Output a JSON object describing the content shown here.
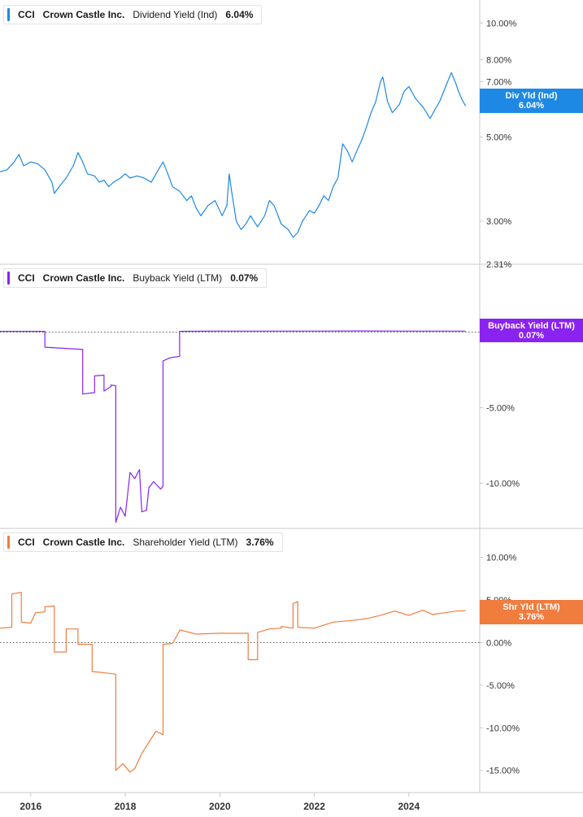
{
  "colors": {
    "dividend": "#1e88e5",
    "buyback": "#8a22f0",
    "shareholder": "#f07c3e",
    "axis": "#c8c8c8",
    "zero_line": "#555555"
  },
  "x_axis": {
    "tick_labels": [
      "2016",
      "2018",
      "2020",
      "2022",
      "2024"
    ],
    "tick_values": [
      2016,
      2018,
      2020,
      2022,
      2024
    ],
    "range": [
      2015.35,
      2025.5
    ]
  },
  "chart_data": [
    {
      "type": "line",
      "legend": {
        "ticker": "CCI",
        "company": "Crown Castle Inc.",
        "metric": "Dividend Yield (Ind)",
        "value": "6.04%"
      },
      "flag": {
        "line1": "Div Yld (Ind)",
        "line2": "6.04%"
      },
      "scale": "log",
      "ylim": [
        2.31,
        11.5
      ],
      "y_ticks": [
        10,
        8,
        7,
        5,
        3,
        2.31
      ],
      "y_tick_labels": [
        "10.00%",
        "8.00%",
        "7.00%",
        "5.00%",
        "3.00%",
        "2.31%"
      ],
      "zero_line": false,
      "series": [
        {
          "points": [
            [
              2015.35,
              4.05
            ],
            [
              2015.5,
              4.1
            ],
            [
              2015.65,
              4.3
            ],
            [
              2015.75,
              4.5
            ],
            [
              2015.85,
              4.2
            ],
            [
              2016.0,
              4.3
            ],
            [
              2016.15,
              4.25
            ],
            [
              2016.3,
              4.1
            ],
            [
              2016.45,
              3.8
            ],
            [
              2016.5,
              3.55
            ],
            [
              2016.6,
              3.7
            ],
            [
              2016.75,
              3.9
            ],
            [
              2016.9,
              4.2
            ],
            [
              2017.0,
              4.55
            ],
            [
              2017.1,
              4.3
            ],
            [
              2017.2,
              4.0
            ],
            [
              2017.35,
              3.95
            ],
            [
              2017.45,
              3.8
            ],
            [
              2017.55,
              3.85
            ],
            [
              2017.65,
              3.7
            ],
            [
              2017.75,
              3.8
            ],
            [
              2017.9,
              3.9
            ],
            [
              2018.0,
              4.0
            ],
            [
              2018.1,
              3.9
            ],
            [
              2018.25,
              3.95
            ],
            [
              2018.4,
              3.9
            ],
            [
              2018.55,
              3.8
            ],
            [
              2018.7,
              4.1
            ],
            [
              2018.8,
              4.3
            ],
            [
              2018.9,
              4.0
            ],
            [
              2019.0,
              3.7
            ],
            [
              2019.15,
              3.6
            ],
            [
              2019.3,
              3.4
            ],
            [
              2019.4,
              3.5
            ],
            [
              2019.5,
              3.25
            ],
            [
              2019.6,
              3.1
            ],
            [
              2019.75,
              3.3
            ],
            [
              2019.9,
              3.4
            ],
            [
              2020.05,
              3.1
            ],
            [
              2020.15,
              3.3
            ],
            [
              2020.2,
              4.0
            ],
            [
              2020.25,
              3.6
            ],
            [
              2020.35,
              3.0
            ],
            [
              2020.45,
              2.85
            ],
            [
              2020.55,
              2.95
            ],
            [
              2020.65,
              3.1
            ],
            [
              2020.8,
              2.9
            ],
            [
              2020.95,
              3.1
            ],
            [
              2021.05,
              3.4
            ],
            [
              2021.15,
              3.3
            ],
            [
              2021.3,
              2.95
            ],
            [
              2021.45,
              2.85
            ],
            [
              2021.55,
              2.72
            ],
            [
              2021.65,
              2.8
            ],
            [
              2021.75,
              3.0
            ],
            [
              2021.9,
              3.2
            ],
            [
              2022.0,
              3.15
            ],
            [
              2022.1,
              3.3
            ],
            [
              2022.2,
              3.5
            ],
            [
              2022.3,
              3.4
            ],
            [
              2022.4,
              3.7
            ],
            [
              2022.5,
              3.9
            ],
            [
              2022.6,
              4.8
            ],
            [
              2022.7,
              4.6
            ],
            [
              2022.8,
              4.3
            ],
            [
              2022.9,
              4.6
            ],
            [
              2023.0,
              4.9
            ],
            [
              2023.1,
              5.3
            ],
            [
              2023.2,
              5.8
            ],
            [
              2023.3,
              6.2
            ],
            [
              2023.4,
              7.0
            ],
            [
              2023.45,
              7.2
            ],
            [
              2023.55,
              6.2
            ],
            [
              2023.65,
              5.8
            ],
            [
              2023.8,
              6.1
            ],
            [
              2023.9,
              6.6
            ],
            [
              2024.0,
              6.8
            ],
            [
              2024.15,
              6.3
            ],
            [
              2024.3,
              6.0
            ],
            [
              2024.45,
              5.6
            ],
            [
              2024.55,
              5.9
            ],
            [
              2024.65,
              6.2
            ],
            [
              2024.8,
              6.9
            ],
            [
              2024.9,
              7.4
            ],
            [
              2025.0,
              6.9
            ],
            [
              2025.05,
              6.6
            ],
            [
              2025.12,
              6.3
            ],
            [
              2025.2,
              6.04
            ]
          ]
        }
      ]
    },
    {
      "type": "line",
      "legend": {
        "ticker": "CCI",
        "company": "Crown Castle Inc.",
        "metric": "Buyback Yield (LTM)",
        "value": "0.07%"
      },
      "flag": {
        "line1": "Buyback Yield (LTM)",
        "line2": "0.07%"
      },
      "scale": "linear",
      "ylim": [
        -13.0,
        4.5
      ],
      "y_ticks": [
        -5,
        -10
      ],
      "y_tick_labels": [
        "-5.00%",
        "-10.00%"
      ],
      "zero_line": true,
      "series": [
        {
          "points": [
            [
              2015.35,
              0.05
            ],
            [
              2016.3,
              0.05
            ],
            [
              2016.3,
              -1.0
            ],
            [
              2016.6,
              -1.05
            ],
            [
              2017.1,
              -1.15
            ],
            [
              2017.1,
              -4.1
            ],
            [
              2017.35,
              -4.0
            ],
            [
              2017.35,
              -2.9
            ],
            [
              2017.55,
              -2.85
            ],
            [
              2017.55,
              -3.9
            ],
            [
              2017.7,
              -3.6
            ],
            [
              2017.7,
              -3.5
            ],
            [
              2017.8,
              -3.55
            ],
            [
              2017.8,
              -12.6
            ],
            [
              2017.9,
              -11.6
            ],
            [
              2018.0,
              -12.2
            ],
            [
              2018.1,
              -9.3
            ],
            [
              2018.2,
              -9.7
            ],
            [
              2018.3,
              -9.1
            ],
            [
              2018.35,
              -11.9
            ],
            [
              2018.45,
              -11.8
            ],
            [
              2018.5,
              -10.3
            ],
            [
              2018.6,
              -9.9
            ],
            [
              2018.75,
              -10.4
            ],
            [
              2018.8,
              -10.2
            ],
            [
              2018.8,
              -1.9
            ],
            [
              2018.95,
              -1.7
            ],
            [
              2019.15,
              -1.6
            ],
            [
              2019.15,
              0.05
            ],
            [
              2020.0,
              0.07
            ],
            [
              2021.0,
              0.07
            ],
            [
              2022.0,
              0.07
            ],
            [
              2023.0,
              0.08
            ],
            [
              2024.0,
              0.07
            ],
            [
              2025.2,
              0.07
            ]
          ]
        }
      ]
    },
    {
      "type": "line",
      "legend": {
        "ticker": "CCI",
        "company": "Crown Castle Inc.",
        "metric": "Shareholder Yield (LTM)",
        "value": "3.76%"
      },
      "flag": {
        "line1": "Shr Yld (LTM)",
        "line2": "3.76%"
      },
      "scale": "linear",
      "ylim": [
        -17.6,
        13.4
      ],
      "y_ticks": [
        10,
        5,
        0,
        -5,
        -10,
        -15
      ],
      "y_tick_labels": [
        "10.00%",
        "5.00%",
        "0.00%",
        "-5.00%",
        "-10.00%",
        "-15.00%"
      ],
      "zero_line": true,
      "series": [
        {
          "points": [
            [
              2015.35,
              1.7
            ],
            [
              2015.6,
              1.8
            ],
            [
              2015.6,
              5.7
            ],
            [
              2015.8,
              5.9
            ],
            [
              2015.8,
              2.4
            ],
            [
              2016.0,
              2.3
            ],
            [
              2016.1,
              3.5
            ],
            [
              2016.3,
              3.6
            ],
            [
              2016.3,
              4.2
            ],
            [
              2016.5,
              4.3
            ],
            [
              2016.5,
              -1.1
            ],
            [
              2016.75,
              -1.1
            ],
            [
              2016.75,
              1.6
            ],
            [
              2017.0,
              1.6
            ],
            [
              2017.0,
              -0.2
            ],
            [
              2017.3,
              -0.2
            ],
            [
              2017.3,
              -3.4
            ],
            [
              2017.5,
              -3.5
            ],
            [
              2017.8,
              -3.7
            ],
            [
              2017.8,
              -15.0
            ],
            [
              2017.95,
              -14.2
            ],
            [
              2018.1,
              -15.2
            ],
            [
              2018.2,
              -14.8
            ],
            [
              2018.35,
              -13.0
            ],
            [
              2018.5,
              -11.7
            ],
            [
              2018.65,
              -10.4
            ],
            [
              2018.8,
              -10.8
            ],
            [
              2018.8,
              -0.2
            ],
            [
              2019.0,
              -0.1
            ],
            [
              2019.15,
              1.4
            ],
            [
              2019.15,
              1.5
            ],
            [
              2019.5,
              1.0
            ],
            [
              2020.0,
              1.1
            ],
            [
              2020.6,
              1.1
            ],
            [
              2020.6,
              -2.0
            ],
            [
              2020.8,
              -2.0
            ],
            [
              2020.8,
              1.2
            ],
            [
              2021.05,
              1.6
            ],
            [
              2021.3,
              1.7
            ],
            [
              2021.3,
              1.9
            ],
            [
              2021.55,
              1.7
            ],
            [
              2021.55,
              4.6
            ],
            [
              2021.65,
              4.8
            ],
            [
              2021.65,
              1.8
            ],
            [
              2022.0,
              1.7
            ],
            [
              2022.4,
              2.4
            ],
            [
              2022.8,
              2.6
            ],
            [
              2023.1,
              2.8
            ],
            [
              2023.4,
              3.2
            ],
            [
              2023.7,
              3.7
            ],
            [
              2024.0,
              3.2
            ],
            [
              2024.3,
              3.8
            ],
            [
              2024.5,
              3.3
            ],
            [
              2024.75,
              3.5
            ],
            [
              2025.0,
              3.7
            ],
            [
              2025.2,
              3.76
            ]
          ]
        }
      ]
    }
  ]
}
